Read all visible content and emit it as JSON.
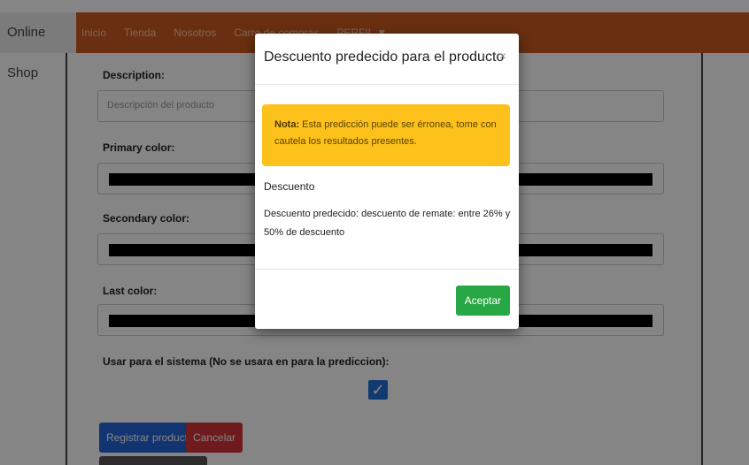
{
  "navbar": {
    "brand": "Online Shop",
    "links": [
      "Inicio",
      "Tienda",
      "Nosotros",
      "Carro de compras",
      "PERFIL ▼"
    ]
  },
  "form": {
    "description_label": "Description:",
    "description_placeholder": "Descripción del producto",
    "primary_label": "Primary color:",
    "secondary_label": "Secondary color:",
    "last_label": "Last color:",
    "system_label": "Usar para el sistema (No se usara en para la prediccion):",
    "checkbox_checked": true,
    "register_button": "Registrar producto",
    "cancel_button": "Cancelar"
  },
  "modal": {
    "title": "Descuento predecido para el producto",
    "close": "×",
    "alert_bold": "Nota:",
    "alert_text": " Esta predicción puede ser érronea, tome con cautela los resultados presentes.",
    "result_title": "Descuento",
    "result_text": "Descuento predecido: descuento de remate: entre 26% y 50% de descuento",
    "accept_button": "Aceptar"
  },
  "colors": {
    "navbar": "#c95a1f",
    "alert": "#fcc11b",
    "accept": "#28a745",
    "primary": "#2466d8",
    "danger": "#d5353a"
  }
}
